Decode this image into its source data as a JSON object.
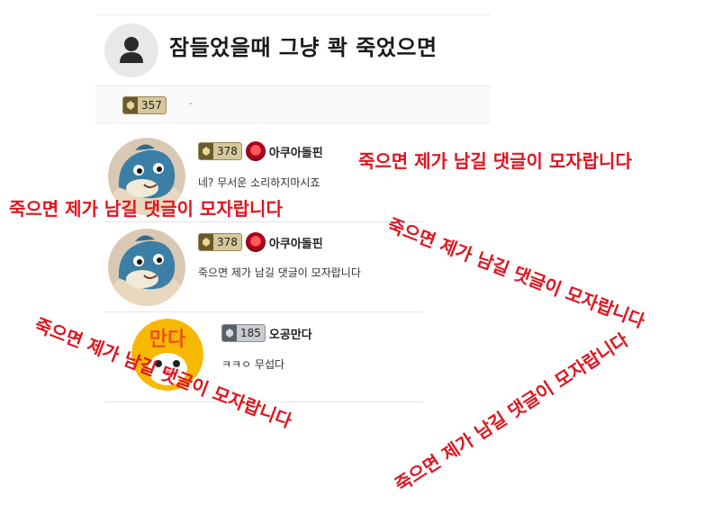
{
  "post": {
    "title": "잠들었을때 그냥 콱 죽었으면",
    "author_level": "357",
    "dash": "-"
  },
  "comments": [
    {
      "level": "378",
      "nickname": "아쿠아돌핀",
      "text": "네? 무서운 소리하지마시죠"
    },
    {
      "level": "378",
      "nickname": "아쿠아돌핀",
      "text": "죽으면 제가 남길 댓글이 모자랍니다"
    },
    {
      "level": "185",
      "nickname": "오공만다",
      "text": "ㅋㅋㅇ 무섭다",
      "avatar_label": "만다"
    }
  ],
  "overlay_caption": "죽으면 제가 남길 댓글이 모자랍니다",
  "colors": {
    "overlay_red": "#e0141e",
    "level_gold": "#d6c89c",
    "level_gray": "#c9ccd1"
  }
}
